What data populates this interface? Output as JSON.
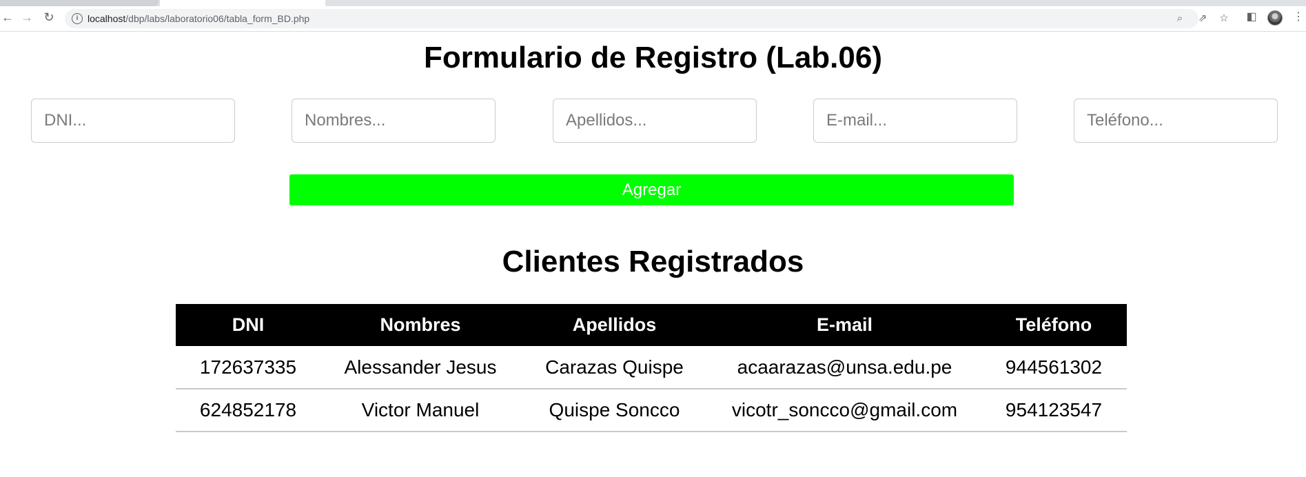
{
  "browser": {
    "url_host": "localhost",
    "url_path": "/dbp/labs/laboratorio06/tabla_form_BD.php"
  },
  "form": {
    "title": "Formulario de Registro (Lab.06)",
    "fields": {
      "dni": {
        "placeholder": "DNI..."
      },
      "nombres": {
        "placeholder": "Nombres..."
      },
      "apellidos": {
        "placeholder": "Apellidos..."
      },
      "email": {
        "placeholder": "E-mail..."
      },
      "telefono": {
        "placeholder": "Teléfono..."
      }
    },
    "submit_label": "Agregar",
    "submit_color": "#00ff00"
  },
  "clientes": {
    "title": "Clientes Registrados",
    "columns": [
      "DNI",
      "Nombres",
      "Apellidos",
      "E-mail",
      "Teléfono"
    ],
    "rows": [
      [
        "172637335",
        "Alessander Jesus",
        "Carazas Quispe",
        "acaarazas@unsa.edu.pe",
        "944561302"
      ],
      [
        "624852178",
        "Victor Manuel",
        "Quispe Soncco",
        "vicotr_soncco@gmail.com",
        "954123547"
      ]
    ]
  }
}
